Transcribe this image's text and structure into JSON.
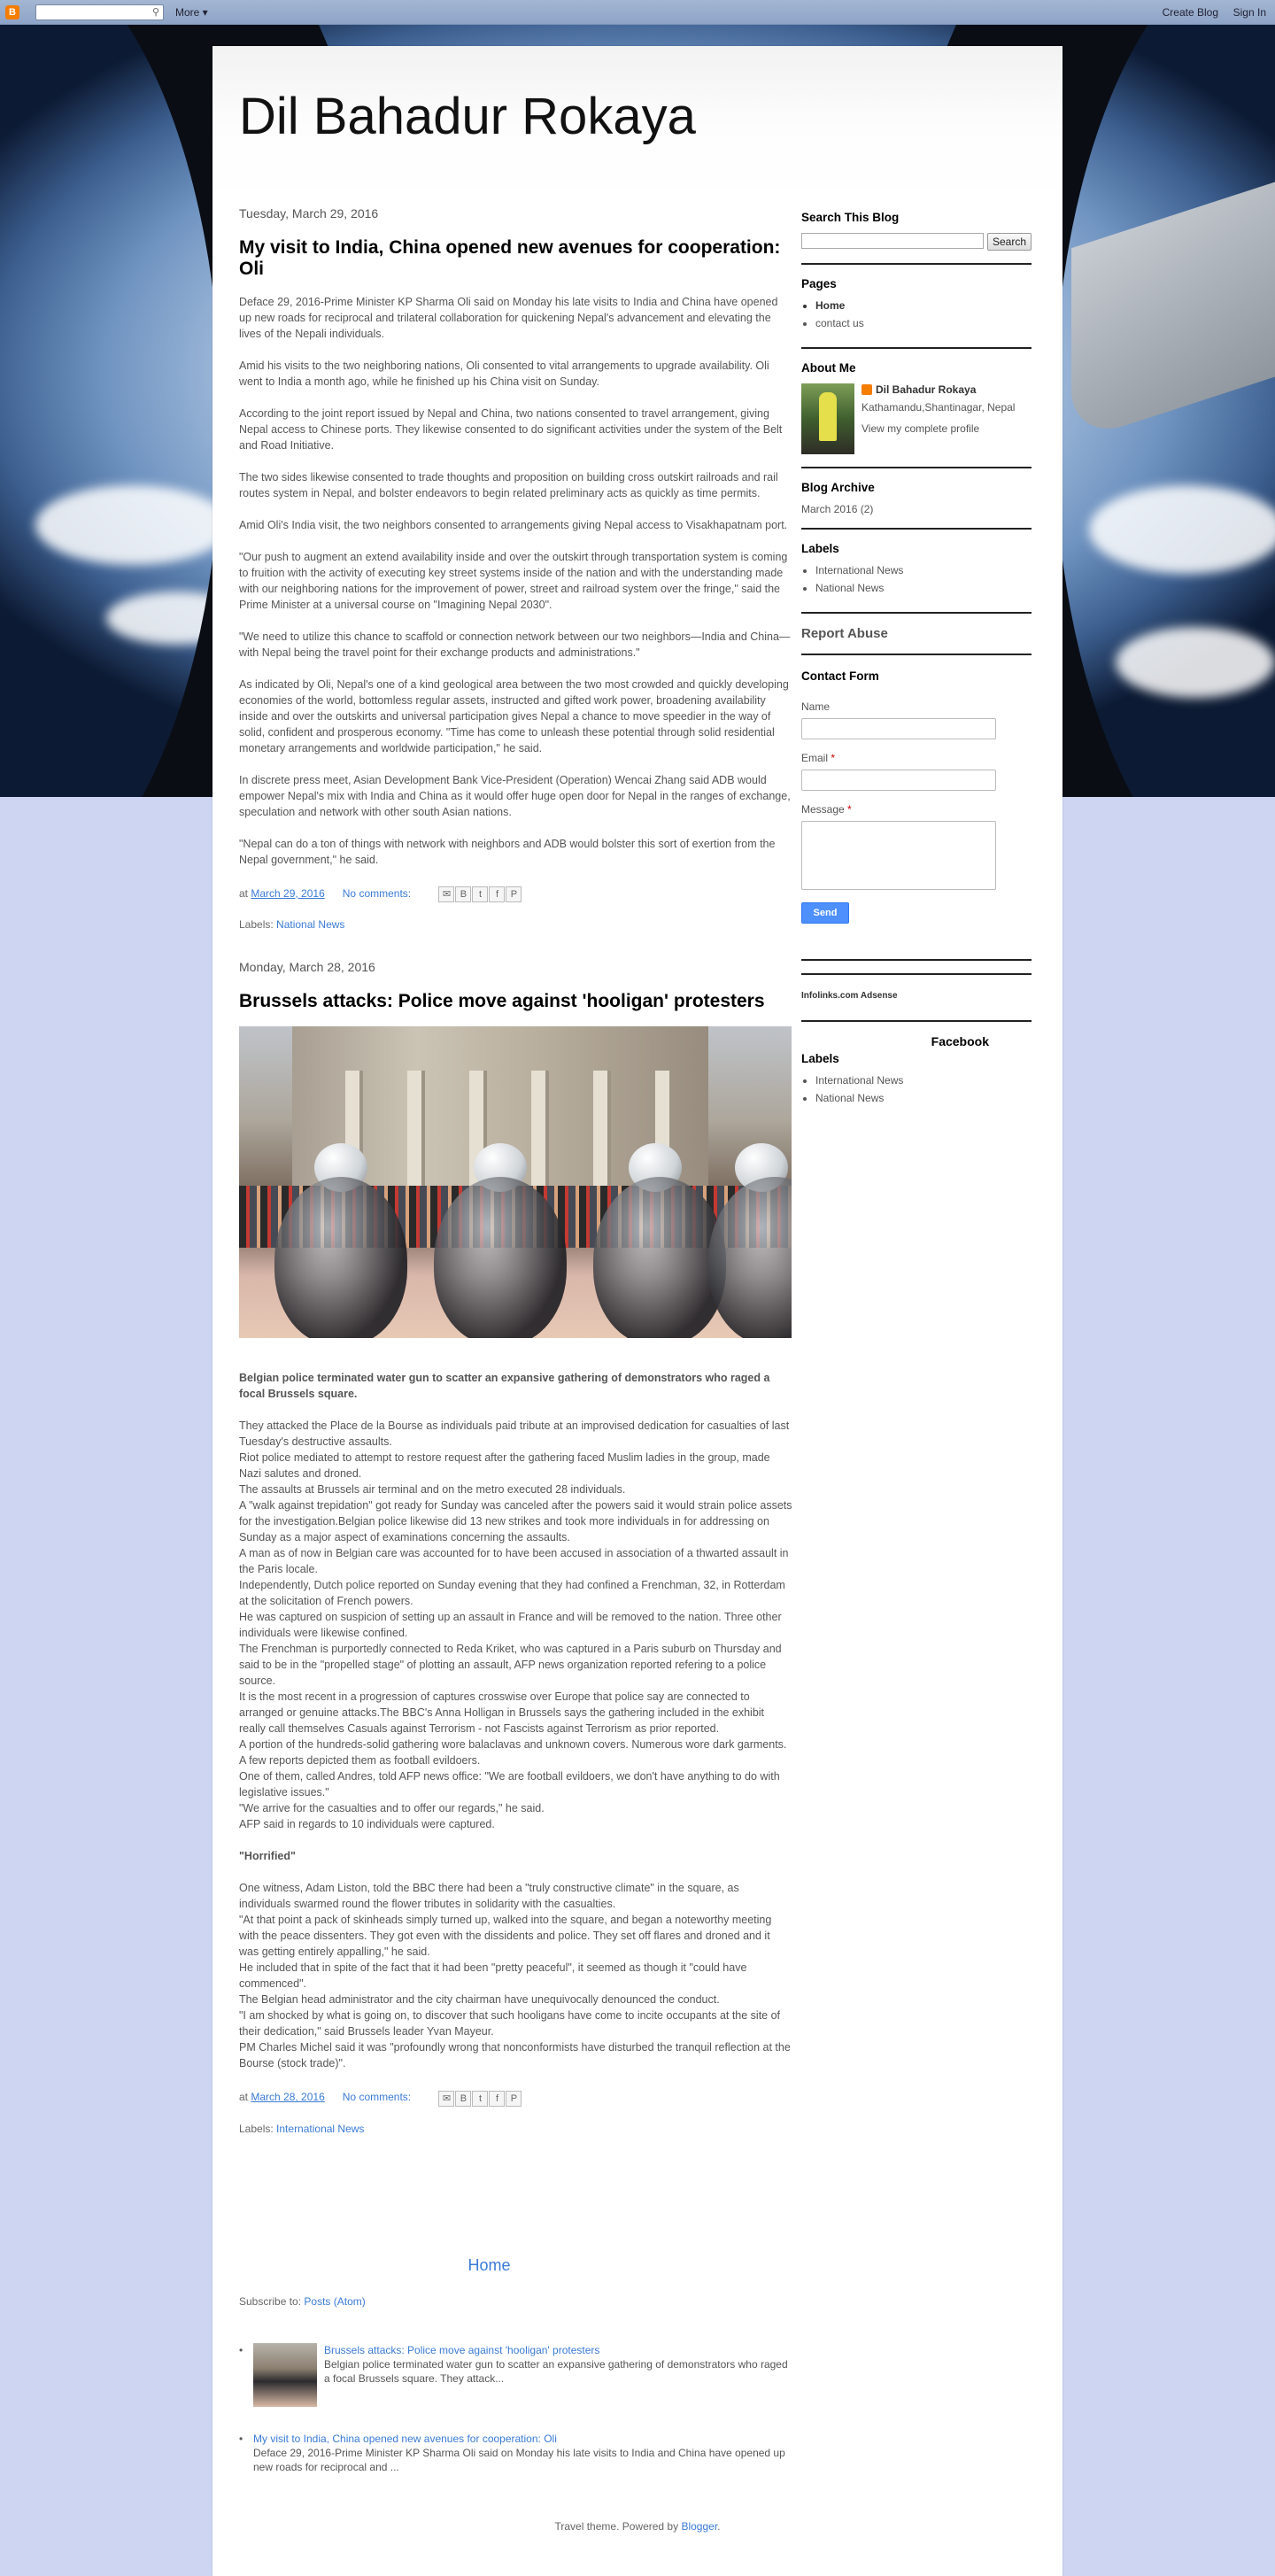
{
  "topbar": {
    "more": "More ▾",
    "create": "Create Blog",
    "signin": "Sign In"
  },
  "blog_title": "Dil Bahadur Rokaya",
  "post1": {
    "date": "Tuesday, March 29, 2016",
    "title": "My visit to India, China opened new avenues for cooperation: Oli",
    "paras": [
      "Deface 29, 2016-Prime Minister KP Sharma Oli said on Monday his late visits to India and China have opened up new roads for reciprocal and trilateral collaboration for quickening Nepal's advancement and elevating the lives of the Nepali individuals.",
      "Amid his visits to the two neighboring nations, Oli consented to vital arrangements to upgrade availability. Oli went to India a month ago, while he finished up his China visit on Sunday.",
      "According to the joint report issued by Nepal and China, two nations consented to travel arrangement, giving Nepal access to Chinese ports. They likewise consented to do significant activities under the system of the Belt and Road Initiative.",
      "The two sides likewise consented to trade thoughts and proposition on building cross outskirt railroads and rail routes system in Nepal, and bolster endeavors to begin related preliminary acts as quickly as time permits.",
      "Amid Oli's India visit, the two neighbors consented to arrangements giving Nepal access to Visakhapatnam port.",
      "\"Our push to augment an extend availability inside and over the outskirt through transportation system is coming to fruition with the activity of executing key street systems inside of the nation and with the understanding made with our neighboring nations for the improvement of power, street and railroad system over the fringe,\" said the Prime Minister at a universal course on \"Imagining Nepal 2030\".",
      "\"We need to utilize this chance to scaffold or connection network between our two neighbors—India and China—with Nepal being the travel point for their exchange products and administrations.\"",
      "As indicated by Oli, Nepal's one of a kind geological area between the two most crowded and quickly developing economies of the world, bottomless regular assets, instructed and gifted work power, broadening availability inside and over the outskirts and universal participation gives Nepal a chance to move speedier in the way of solid, confident and prosperous economy. \"Time has come to unleash these potential through solid residential monetary arrangements and worldwide participation,\" he said.",
      "In discrete press meet, Asian Development Bank Vice-President (Operation) Wencai Zhang said ADB would empower Nepal's mix with India and China as it would offer huge open door for Nepal in the ranges of exchange, speculation and network with other south Asian nations.",
      "\"Nepal can do a ton of things with network with neighbors and ADB would bolster this sort of exertion from the Nepal government,\" he said."
    ],
    "at": "at",
    "time": "March 29, 2016",
    "comments": "No comments:",
    "labels_prefix": "Labels:",
    "label": "National News"
  },
  "post2": {
    "date": "Monday, March 28, 2016",
    "title": "Brussels attacks: Police move against 'hooligan' protesters",
    "lead": "Belgian police terminated water gun to scatter an expansive gathering of demonstrators who raged a focal Brussels square.",
    "lines": [
      "They attacked the Place de la Bourse as individuals paid tribute at an improvised dedication for casualties of last Tuesday's destructive assaults.",
      "Riot police mediated to attempt to restore request after the gathering faced Muslim ladies in the group, made Nazi salutes and droned.",
      "The assaults at Brussels air terminal and on the metro executed 28 individuals.",
      "A \"walk against trepidation\" got ready for Sunday was canceled after the powers said it would strain police assets for the investigation.Belgian police likewise did 13 new strikes and took more individuals in for addressing on Sunday as a major aspect of examinations concerning the assaults.",
      "A man as of now in Belgian care was accounted for to have been accused in association of a thwarted assault in the Paris locale.",
      "Independently, Dutch police reported on Sunday evening that they had confined a Frenchman, 32, in Rotterdam at the solicitation of French powers.",
      "He was captured on suspicion of setting up an assault in France and will be removed to the nation. Three other individuals were likewise confined.",
      "The Frenchman is purportedly connected to Reda Kriket, who was captured in a Paris suburb on Thursday and said to be in the \"propelled stage\" of plotting an assault, AFP news organization reported refering to a police source.",
      "It is the most recent in a progression of captures crosswise over Europe that police say are connected to arranged or genuine attacks.The BBC's Anna Holligan in Brussels says the gathering included in the exhibit really call themselves Casuals against Terrorism - not Fascists against Terrorism as prior reported.",
      "A portion of the hundreds-solid gathering wore balaclavas and unknown covers. Numerous wore dark garments. A few reports depicted them as football evildoers.",
      "One of them, called Andres, told AFP news office: \"We are football evildoers, we don't have anything to do with legislative issues.\"",
      "\"We arrive for the casualties and to offer our regards,\" he said.",
      "AFP said in regards to 10 individuals were captured."
    ],
    "subhead": "\"Horrified\"",
    "lines2": [
      "One witness, Adam Liston, told the BBC there had been a \"truly constructive climate\" in the square, as individuals swarmed round the flower tributes in solidarity with the casualties.",
      "\"At that point a pack of skinheads simply turned up, walked into the square, and began a noteworthy meeting with the peace dissenters. They got even with the dissidents and police. They set off flares and droned and it was getting entirely appalling,\" he said.",
      "He included that in spite of the fact that it had been \"pretty peaceful\", it seemed as though it \"could have commenced\".",
      "The Belgian head administrator and the city chairman have unequivocally denounced the conduct.",
      "\"I am shocked by what is going on, to discover that such hooligans have come to incite occupants at the site of their dedication,\" said Brussels leader Yvan Mayeur.",
      "PM Charles Michel said it was \"profoundly wrong that nonconformists have disturbed the tranquil reflection at the Bourse (stock trade)\"."
    ],
    "at": "at",
    "time": "March 28, 2016",
    "comments": "No comments:",
    "labels_prefix": "Labels:",
    "label": "International News"
  },
  "home": "Home",
  "subscribe": {
    "prefix": "Subscribe to:",
    "link": "Posts (Atom)"
  },
  "popular": [
    {
      "title": "Brussels attacks: Police move against 'hooligan' protesters",
      "snippet": "Belgian police terminated water gun to scatter an expansive gathering of demonstrators who raged a focal Brussels square.  They attack..."
    },
    {
      "title": "My visit to India, China opened new avenues for cooperation: Oli",
      "snippet": "Deface 29, 2016-Prime Minister KP Sharma Oli said on Monday his late visits to India and China have opened up new roads for reciprocal and ..."
    }
  ],
  "powered": {
    "prefix": "Travel theme. Powered by",
    "link": "Blogger",
    "suffix": "."
  },
  "sidebar": {
    "search_title": "Search This Blog",
    "search_btn": "Search",
    "pages_title": "Pages",
    "pages": [
      "Home",
      "contact us"
    ],
    "about_title": "About Me",
    "about_name": "Dil Bahadur Rokaya",
    "about_loc": "Kathamandu,Shantinagar, Nepal",
    "about_profile": "View my complete profile",
    "archive_title": "Blog Archive",
    "archive_item": "March 2016 (2)",
    "labels_title": "Labels",
    "labels": [
      "International News",
      "National News"
    ],
    "report": "Report Abuse",
    "contact_title": "Contact Form",
    "name_label": "Name",
    "email_label": "Email",
    "message_label": "Message",
    "req": "*",
    "send": "Send",
    "infolinks": "Infolinks.com Adsense",
    "facebook": "Facebook",
    "labels2_title": "Labels",
    "labels2": [
      "International News",
      "National News"
    ]
  }
}
